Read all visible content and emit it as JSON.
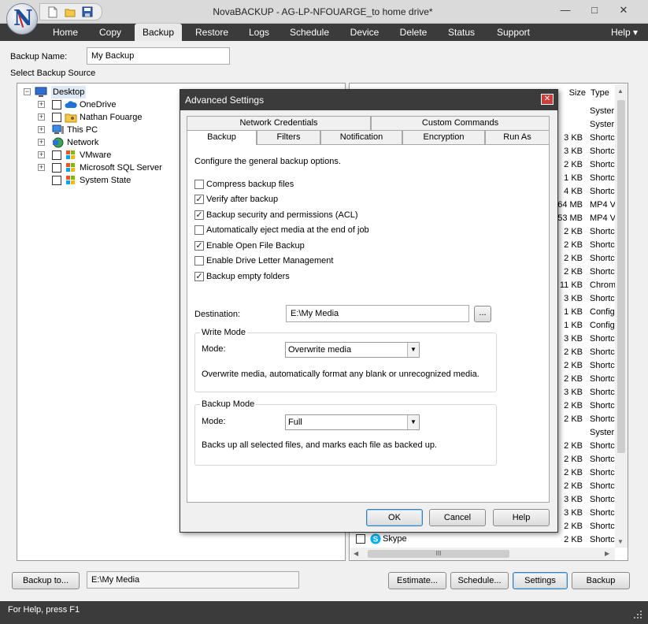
{
  "window": {
    "title": "NovaBACKUP - AG-LP-NFOUARGE_to home drive*",
    "minimize_glyph": "—",
    "maximize_glyph": "□",
    "close_glyph": "✕"
  },
  "menu": {
    "items": [
      "Home",
      "Copy",
      "Backup",
      "Restore",
      "Logs",
      "Schedule",
      "Device",
      "Delete",
      "Status",
      "Support"
    ],
    "active": "Backup",
    "help": "Help ▾"
  },
  "backup_name": {
    "label": "Backup Name:",
    "value": "My Backup"
  },
  "source_label": "Select Backup Source",
  "tree": {
    "root": "Desktop",
    "items": [
      {
        "label": "OneDrive",
        "icon": "cloud-icon"
      },
      {
        "label": "Nathan Fouarge",
        "icon": "user-folder-icon"
      },
      {
        "label": "This PC",
        "icon": "computer-icon"
      },
      {
        "label": "Network",
        "icon": "network-icon"
      },
      {
        "label": "VMware",
        "icon": "windows-folder-icon"
      },
      {
        "label": "Microsoft SQL Server",
        "icon": "windows-folder-icon"
      },
      {
        "label": "System State",
        "icon": "windows-folder-icon"
      }
    ]
  },
  "file_list": {
    "headers": {
      "size": "Size",
      "type": "Type"
    },
    "rows": [
      {
        "size": "",
        "type": "Syster"
      },
      {
        "size": "",
        "type": "Syster"
      },
      {
        "size": "3 KB",
        "type": "Shortc"
      },
      {
        "size": "3 KB",
        "type": "Shortc"
      },
      {
        "size": "2 KB",
        "type": "Shortc"
      },
      {
        "size": "1 KB",
        "type": "Shortc"
      },
      {
        "size": "4 KB",
        "type": "Shortc"
      },
      {
        "size": "64 MB",
        "type": "MP4 V"
      },
      {
        "size": "53 MB",
        "type": "MP4 V"
      },
      {
        "size": "2 KB",
        "type": "Shortc"
      },
      {
        "size": "2 KB",
        "type": "Shortc"
      },
      {
        "size": "2 KB",
        "type": "Shortc"
      },
      {
        "size": "2 KB",
        "type": "Shortc"
      },
      {
        "size": "11 KB",
        "type": "Chrom"
      },
      {
        "size": "3 KB",
        "type": "Shortc"
      },
      {
        "size": "1 KB",
        "type": "Config"
      },
      {
        "size": "1 KB",
        "type": "Config"
      },
      {
        "size": "3 KB",
        "type": "Shortc"
      },
      {
        "size": "2 KB",
        "type": "Shortc"
      },
      {
        "size": "2 KB",
        "type": "Shortc"
      },
      {
        "size": "2 KB",
        "type": "Shortc"
      },
      {
        "size": "3 KB",
        "type": "Shortc"
      },
      {
        "size": "2 KB",
        "type": "Shortc"
      },
      {
        "size": "2 KB",
        "type": "Shortc"
      },
      {
        "size": "",
        "type": "Syster"
      },
      {
        "size": "2 KB",
        "type": "Shortc"
      },
      {
        "size": "2 KB",
        "type": "Shortc"
      },
      {
        "size": "2 KB",
        "type": "Shortc"
      },
      {
        "size": "2 KB",
        "type": "Shortc"
      },
      {
        "size": "3 KB",
        "type": "Shortc"
      },
      {
        "size": "3 KB",
        "type": "Shortc"
      },
      {
        "size": "2 KB",
        "type": "Shortc"
      },
      {
        "size": "2 KB",
        "type": "Shortc"
      },
      {
        "size": "3 KB",
        "type": "Shortc"
      }
    ],
    "last_item": "Skype",
    "hscroll_grip": "III"
  },
  "dialog": {
    "title": "Advanced Settings",
    "close_glyph": "✕",
    "tabs_back": [
      "Network Credentials",
      "Custom Commands"
    ],
    "tabs_front": [
      "Backup",
      "Filters",
      "Notification",
      "Encryption",
      "Run As"
    ],
    "intro": "Configure the general backup options.",
    "options": [
      {
        "label": "Compress backup files",
        "checked": false
      },
      {
        "label": "Verify after backup",
        "checked": true
      },
      {
        "label": "Backup security and permissions (ACL)",
        "checked": true
      },
      {
        "label": "Automatically eject media at the end of job",
        "checked": false
      },
      {
        "label": "Enable Open File Backup",
        "checked": true
      },
      {
        "label": "Enable Drive Letter Management",
        "checked": false
      },
      {
        "label": "Backup empty folders",
        "checked": true
      }
    ],
    "check_glyph": "✓",
    "destination": {
      "label": "Destination:",
      "value": "E:\\My Media",
      "browse": "..."
    },
    "write_mode": {
      "title": "Write Mode",
      "mode_label": "Mode:",
      "value": "Overwrite media",
      "description": "Overwrite media, automatically format any blank or unrecognized media."
    },
    "backup_mode": {
      "title": "Backup Mode",
      "mode_label": "Mode:",
      "value": "Full",
      "description": "Backs up all selected files, and marks each file as backed up."
    },
    "buttons": {
      "ok": "OK",
      "cancel": "Cancel",
      "help": "Help"
    }
  },
  "bottom": {
    "backup_to": "Backup to...",
    "destination_value": "E:\\My Media",
    "estimate": "Estimate...",
    "schedule": "Schedule...",
    "settings": "Settings",
    "backup": "Backup"
  },
  "status": {
    "text": "For Help, press F1"
  },
  "colors": {
    "chrome_dark": "#3b3b3b",
    "accent_blue": "#3c7fb1",
    "close_red": "#c9403a"
  }
}
